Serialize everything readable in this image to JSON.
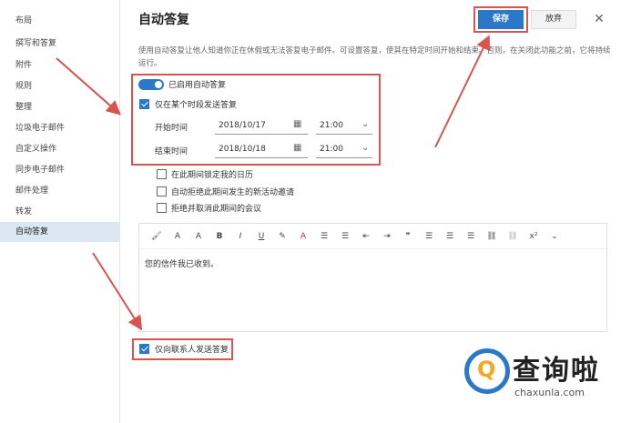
{
  "sidebar": {
    "items": [
      {
        "label": "布局"
      },
      {
        "label": "撰写和答复"
      },
      {
        "label": "附件"
      },
      {
        "label": "规则"
      },
      {
        "label": "整理"
      },
      {
        "label": "垃圾电子邮件"
      },
      {
        "label": "自定义操作"
      },
      {
        "label": "同步电子邮件"
      },
      {
        "label": "邮件处理"
      },
      {
        "label": "转发"
      },
      {
        "label": "自动答复"
      }
    ]
  },
  "header": {
    "title": "自动答复",
    "save_label": "保存",
    "discard_label": "放弃",
    "close_glyph": "✕"
  },
  "description": "使用自动答复让他人知道你正在休假或无法答复电子邮件。可设置答复，使其在特定时间开始和结束。否则，在关闭此功能之前，它将持续运行。",
  "auto_reply": {
    "toggle_label": "已启用自动答复",
    "toggle_on": true,
    "period_label": "仅在某个时段发送答复",
    "period_checked": true,
    "start_label": "开始时间",
    "start_date": "2018/10/17",
    "start_time": "21:00",
    "end_label": "结束时间",
    "end_date": "2018/10/18",
    "end_time": "21:00"
  },
  "options": [
    {
      "label": "在此期间锁定我的日历",
      "checked": false
    },
    {
      "label": "自动拒绝此期间发生的新活动邀请",
      "checked": false
    },
    {
      "label": "拒绝并取消此期间的会议",
      "checked": false
    }
  ],
  "editor": {
    "toolbar": [
      "🖌",
      "A",
      "A",
      "B",
      "I",
      "U",
      "✎",
      "A",
      "☰",
      "☰",
      "⇤",
      "⇥",
      "❞",
      "☰",
      "☰",
      "☰",
      "⛓",
      "⛓",
      "x²",
      "⌄"
    ],
    "body": "您的信件我已收到。"
  },
  "contacts_only": {
    "label": "仅向联系人发送答复",
    "checked": true
  },
  "watermark": {
    "mark": "Q",
    "cn": "查询啦",
    "en": "chaxunla.com"
  },
  "colors": {
    "accent": "#2b78c8",
    "annotation": "#d9534f"
  }
}
